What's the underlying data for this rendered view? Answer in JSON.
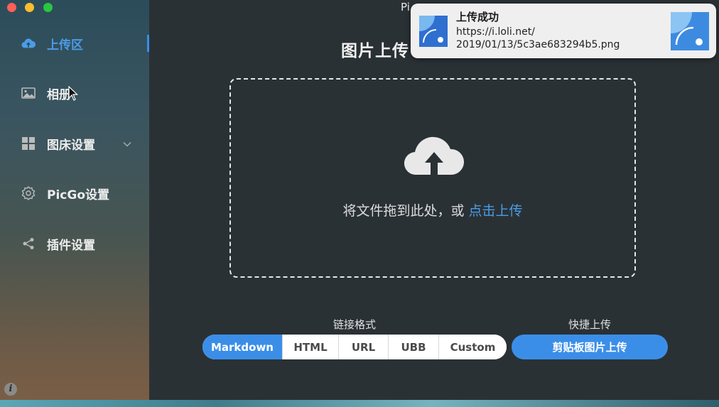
{
  "app": {
    "title": "Pi"
  },
  "sidebar": {
    "items": [
      {
        "label": "上传区",
        "icon": "cloud-upload-icon",
        "active": true
      },
      {
        "label": "相册",
        "icon": "image-icon"
      },
      {
        "label": "图床设置",
        "icon": "grid-icon",
        "expandable": true
      },
      {
        "label": "PicGo设置",
        "icon": "gear-icon"
      },
      {
        "label": "插件设置",
        "icon": "share-icon"
      }
    ],
    "info": "i"
  },
  "main": {
    "title": "图片上传",
    "dropzone": {
      "text": "将文件拖到此处，或 ",
      "link": "点击上传"
    },
    "link_format": {
      "label": "链接格式",
      "options": [
        "Markdown",
        "HTML",
        "URL",
        "UBB",
        "Custom"
      ],
      "selected": "Markdown"
    },
    "quick_upload": {
      "label": "快捷上传",
      "button": "剪贴板图片上传"
    }
  },
  "notification": {
    "title": "上传成功",
    "line1": "https://i.loli.net/",
    "line2": "2019/01/13/5c3ae683294b5.png"
  },
  "colors": {
    "accent": "#3b8ee8",
    "link": "#4b9ce8",
    "background": "#2a3135"
  }
}
